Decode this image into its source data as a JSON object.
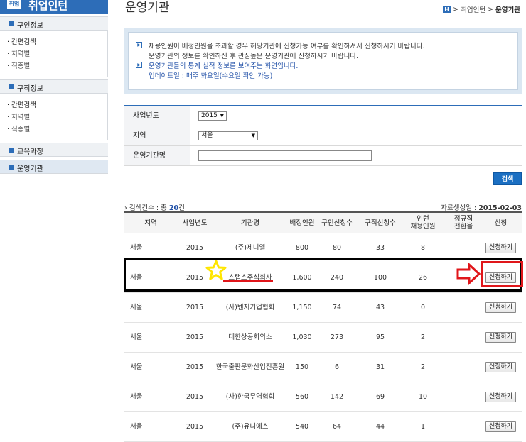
{
  "sidebar": {
    "logo_text": "취업",
    "app_title": "취업인턴",
    "sections": [
      {
        "label": "구인정보",
        "items": [
          "· 간편검색",
          "· 지역별",
          "· 직종별"
        ]
      },
      {
        "label": "구직정보",
        "items": [
          "· 간편검색",
          "· 지역별",
          "· 직종별"
        ]
      },
      {
        "label": "교육과정",
        "items": []
      },
      {
        "label": "운영기관",
        "items": []
      }
    ]
  },
  "page_title": "운영기관",
  "breadcrumb": {
    "home_icon": "H",
    "sep": ">",
    "items": [
      "취업인턴",
      "운영기관"
    ]
  },
  "notice": {
    "lines": [
      "채용인원이 배정인원을 초과할 경우 해당기관에 신청가능 여부를 확인하셔서 신청하시기 바랍니다.",
      "운영기관의 정보를 확인하신 후 관심높은 운영기관에 신청하시기 바랍니다.",
      "운영기관들의 통계 실적 정보를 보여주는 화면입니다.",
      "업데이트일 : 매주 화요일(수요일 확인 가능)"
    ]
  },
  "form": {
    "year_label": "사업년도",
    "year_value": "2015",
    "region_label": "지역",
    "region_value": "서울",
    "org_label": "운영기관명",
    "org_value": ""
  },
  "search_button": "검색",
  "result": {
    "count_prefix": "검색건수 : 총",
    "count": "20",
    "count_suffix": "건",
    "date_label": "자료생성일 :",
    "date_value": "2015-02-03"
  },
  "table": {
    "headers": [
      "지역",
      "사업년도",
      "기관명",
      "배정인원",
      "구인신청수",
      "구직신청수",
      "인턴\n채용인원",
      "정규직\n전환율",
      "신청"
    ],
    "rows": [
      [
        "서울",
        "2015",
        "(주)제니엘",
        "800",
        "80",
        "33",
        "8",
        "",
        "신청하기"
      ],
      [
        "서울",
        "2015",
        "스탭스주식회사",
        "1,600",
        "240",
        "100",
        "26",
        "",
        "신청하기"
      ],
      [
        "서울",
        "2015",
        "(사)벤처기업협회",
        "1,150",
        "74",
        "43",
        "0",
        "",
        "신청하기"
      ],
      [
        "서울",
        "2015",
        "대한상공회의소",
        "1,030",
        "273",
        "95",
        "2",
        "",
        "신청하기"
      ],
      [
        "서울",
        "2015",
        "한국출판문화산업진흥원",
        "150",
        "6",
        "31",
        "2",
        "",
        "신청하기"
      ],
      [
        "서울",
        "2015",
        "(사)한국무역협회",
        "560",
        "142",
        "69",
        "10",
        "",
        "신청하기"
      ],
      [
        "서울",
        "2015",
        "(주)유니에스",
        "540",
        "64",
        "44",
        "1",
        "",
        "신청하기"
      ]
    ]
  },
  "colors": {
    "accent": "#2d6db8",
    "annotation_red": "#e0161a",
    "star": "#ffe600"
  }
}
